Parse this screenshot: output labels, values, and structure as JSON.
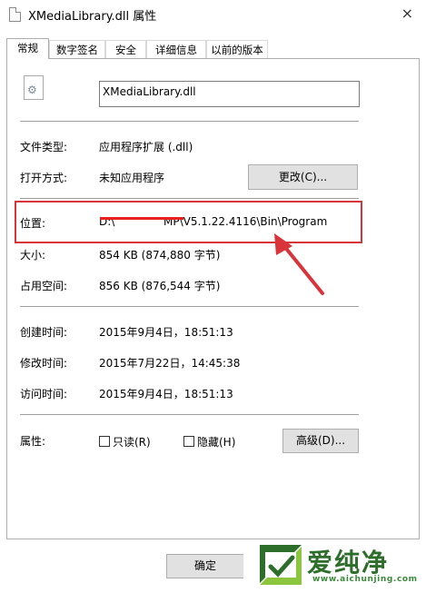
{
  "window": {
    "title": "XMediaLibrary.dll 属性",
    "close_glyph": "×"
  },
  "tabs": [
    {
      "label": "常规",
      "active": true
    },
    {
      "label": "数字签名"
    },
    {
      "label": "安全"
    },
    {
      "label": "详细信息"
    },
    {
      "label": "以前的版本"
    }
  ],
  "general": {
    "file_name": "XMediaLibrary.dll",
    "file_type_label": "文件类型:",
    "file_type_value": "应用程序扩展 (.dll)",
    "opens_with_label": "打开方式:",
    "opens_with_value": "未知应用程序",
    "change_button": "更改(C)...",
    "location_label": "位置:",
    "location_prefix": "D:\\",
    "location_value": "MP\\V5.1.22.4116\\Bin\\Program",
    "size_label": "大小:",
    "size_value": "854 KB (874,880 字节)",
    "size_on_disk_label": "占用空间:",
    "size_on_disk_value": "856 KB (876,544 字节)",
    "created_label": "创建时间:",
    "created_value": "2015年9月4日，18:51:13",
    "modified_label": "修改时间:",
    "modified_value": "2015年7月22日，14:45:38",
    "accessed_label": "访问时间:",
    "accessed_value": "2015年9月4日，18:51:13",
    "attributes_label": "属性:",
    "readonly_label": "只读(R)",
    "hidden_label": "隐藏(H)",
    "advanced_button": "高级(D)..."
  },
  "footer": {
    "ok_button": "确定"
  },
  "watermark": {
    "brand": "爱纯净",
    "url": "www.aichunjing.com"
  },
  "colors": {
    "annotation_red": "#d9343a",
    "watermark_green": "#2d6e2a"
  }
}
